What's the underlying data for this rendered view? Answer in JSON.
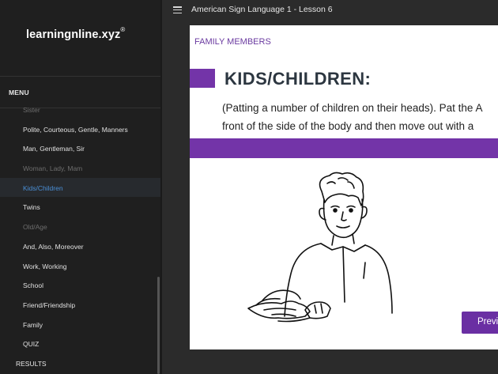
{
  "sidebar": {
    "logo": {
      "part1": "learningnline.",
      "part2": "xyz",
      "reg": "®"
    },
    "menu_header": "MENU",
    "items": [
      {
        "label": "Sister",
        "state": "dim"
      },
      {
        "label": "Polite, Courteous, Gentle, Manners",
        "state": "normal"
      },
      {
        "label": "Man, Gentleman, Sir",
        "state": "normal"
      },
      {
        "label": "Woman, Lady, Mam",
        "state": "dim"
      },
      {
        "label": "Kids/Children",
        "state": "active"
      },
      {
        "label": "Twins",
        "state": "normal"
      },
      {
        "label": "Old/Age",
        "state": "dim"
      },
      {
        "label": "And, Also, Moreover",
        "state": "normal"
      },
      {
        "label": "Work, Working",
        "state": "normal"
      },
      {
        "label": "School",
        "state": "normal"
      },
      {
        "label": "Friend/Friendship",
        "state": "normal"
      },
      {
        "label": "Family",
        "state": "normal"
      },
      {
        "label": "QUIZ",
        "state": "normal"
      },
      {
        "label": "RESULTS",
        "state": "section"
      }
    ]
  },
  "topbar": {
    "menu_icon": "hamburger-icon",
    "title": "American Sign Language 1 - Lesson 6"
  },
  "slide": {
    "section_label": "FAMILY MEMBERS",
    "title": "KIDS/CHILDREN:",
    "desc_line1": "(Patting a number of children on their heads). Pat the A",
    "desc_line2": "front of the side of the body and then move out with a",
    "prev_label": "Previ"
  },
  "colors": {
    "accent_purple": "#7334a8",
    "active_link": "#4a8fd6",
    "sidebar_bg": "#1f1f1f"
  }
}
